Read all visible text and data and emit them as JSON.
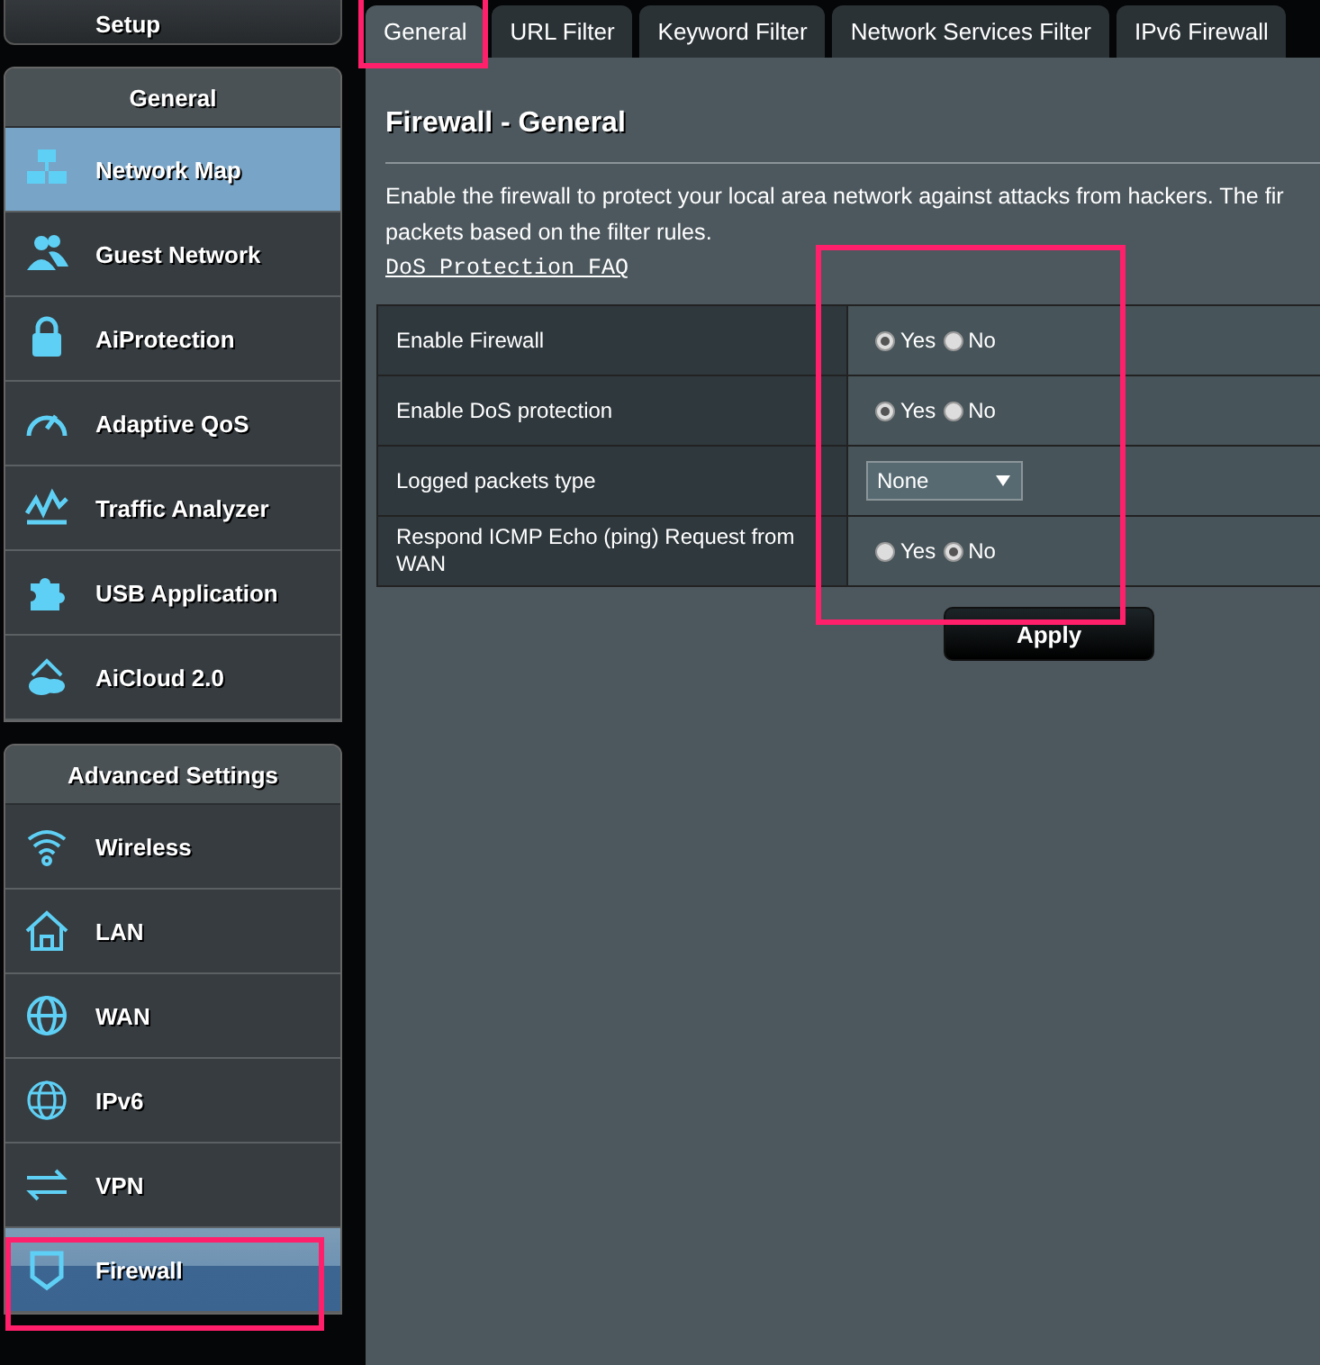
{
  "sidebar": {
    "setup": {
      "label": "Setup"
    },
    "sections": [
      {
        "title": "General",
        "items": [
          {
            "label": "Network Map",
            "selected": true
          },
          {
            "label": "Guest Network",
            "selected": false
          },
          {
            "label": "AiProtection",
            "selected": false
          },
          {
            "label": "Adaptive QoS",
            "selected": false
          },
          {
            "label": "Traffic Analyzer",
            "selected": false
          },
          {
            "label": "USB Application",
            "selected": false
          },
          {
            "label": "AiCloud 2.0",
            "selected": false
          }
        ]
      },
      {
        "title": "Advanced Settings",
        "items": [
          {
            "label": "Wireless",
            "selected": false
          },
          {
            "label": "LAN",
            "selected": false
          },
          {
            "label": "WAN",
            "selected": false
          },
          {
            "label": "IPv6",
            "selected": false
          },
          {
            "label": "VPN",
            "selected": false
          },
          {
            "label": "Firewall",
            "selected": true
          }
        ]
      }
    ]
  },
  "tabs": [
    {
      "label": "General",
      "selected": true
    },
    {
      "label": "URL Filter",
      "selected": false
    },
    {
      "label": "Keyword Filter",
      "selected": false
    },
    {
      "label": "Network Services Filter",
      "selected": false
    },
    {
      "label": "IPv6 Firewall",
      "selected": false
    }
  ],
  "page": {
    "title": "Firewall - General",
    "description_lines": [
      "Enable the firewall to protect your local area network against attacks from hackers. The fir",
      "packets based on the filter rules."
    ],
    "faq_link": "DoS Protection FAQ"
  },
  "settings": [
    {
      "label": "Enable Firewall",
      "kind": "radio",
      "options": [
        {
          "label": "Yes",
          "selected": true
        },
        {
          "label": "No",
          "selected": false
        }
      ]
    },
    {
      "label": "Enable DoS protection",
      "kind": "radio",
      "options": [
        {
          "label": "Yes",
          "selected": true
        },
        {
          "label": "No",
          "selected": false
        }
      ]
    },
    {
      "label": "Logged packets type",
      "kind": "select",
      "value": "None"
    },
    {
      "label": "Respond ICMP Echo (ping) Request from WAN",
      "kind": "radio",
      "options": [
        {
          "label": "Yes",
          "selected": false
        },
        {
          "label": "No",
          "selected": true
        }
      ]
    }
  ],
  "apply_button": "Apply"
}
